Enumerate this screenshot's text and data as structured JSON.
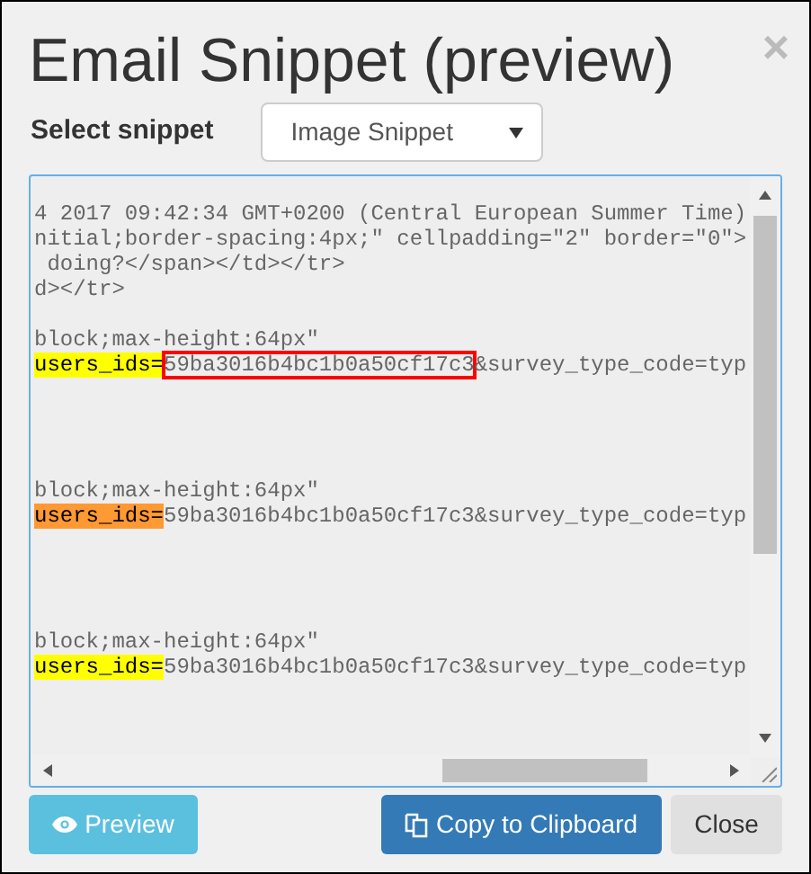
{
  "dialog": {
    "title": "Email Snippet (preview)",
    "close_glyph": "×"
  },
  "snippet_select": {
    "label": "Select snippet",
    "value": "Image Snippet"
  },
  "code_lines": [
    {
      "kind": "text",
      "text": "4 2017 09:42:34 GMT+0200 (Central European Summer Time)"
    },
    {
      "kind": "text",
      "text": "nitial;border-spacing:4px;\" cellpadding=\"2\" border=\"0\">"
    },
    {
      "kind": "text",
      "text": " doing?</span></td></tr>"
    },
    {
      "kind": "text",
      "text": "d></tr>"
    },
    {
      "kind": "blank"
    },
    {
      "kind": "text",
      "text": "block;max-height:64px\""
    },
    {
      "kind": "param",
      "key": "users_ids=",
      "color": "#ffff00",
      "value": "59ba3016b4bc1b0a50cf17c3",
      "boxed": true,
      "rest": "&survey_type_code=typ"
    },
    {
      "kind": "blank"
    },
    {
      "kind": "blank"
    },
    {
      "kind": "blank"
    },
    {
      "kind": "blank"
    },
    {
      "kind": "text",
      "text": "block;max-height:64px\""
    },
    {
      "kind": "param",
      "key": "users_ids=",
      "color": "#ff9933",
      "value": "59ba3016b4bc1b0a50cf17c3",
      "boxed": false,
      "rest": "&survey_type_code=typ"
    },
    {
      "kind": "blank"
    },
    {
      "kind": "blank"
    },
    {
      "kind": "blank"
    },
    {
      "kind": "blank"
    },
    {
      "kind": "text",
      "text": "block;max-height:64px\""
    },
    {
      "kind": "param",
      "key": "users_ids=",
      "color": "#ffff00",
      "value": "59ba3016b4bc1b0a50cf17c3",
      "boxed": false,
      "rest": "&survey_type_code=typ"
    }
  ],
  "buttons": [
    {
      "kind": "preview",
      "label": "Preview"
    },
    {
      "kind": "copy",
      "label": "Copy to Clipboard"
    },
    {
      "kind": "close",
      "label": "Close"
    }
  ]
}
